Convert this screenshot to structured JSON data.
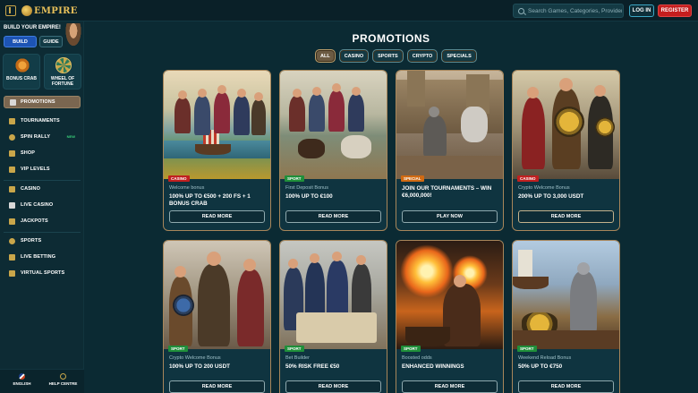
{
  "brand": {
    "logo_text": "EMPIRE"
  },
  "header": {
    "search_placeholder": "Search Games, Categories, Providers",
    "login_label": "LOG IN",
    "register_label": "REGISTER"
  },
  "sidebar": {
    "build_title": "BUILD YOUR EMPIRE!",
    "build_button": "BUILD",
    "guide_button": "GUIDE",
    "tiles": [
      {
        "label": "BONUS CRAB",
        "icon": "crab-coin-icon"
      },
      {
        "label": "WHEEL OF FORTUNE",
        "icon": "wheel-icon"
      }
    ],
    "active_item": {
      "label": "PROMOTIONS",
      "icon": "gift-icon"
    },
    "group1": [
      {
        "label": "TOURNAMENTS",
        "icon": "trophy-icon"
      },
      {
        "label": "SPIN RALLY",
        "icon": "spin-icon",
        "badge": "NEW"
      },
      {
        "label": "SHOP",
        "icon": "shop-icon"
      },
      {
        "label": "VIP LEVELS",
        "icon": "crown-icon"
      }
    ],
    "group2": [
      {
        "label": "CASINO",
        "icon": "casino-icon"
      },
      {
        "label": "LIVE CASINO",
        "icon": "live-casino-icon"
      },
      {
        "label": "JACKPOTS",
        "icon": "jackpot-icon"
      }
    ],
    "group3": [
      {
        "label": "SPORTS",
        "icon": "sports-icon"
      },
      {
        "label": "LIVE BETTING",
        "icon": "live-betting-icon"
      },
      {
        "label": "VIRTUAL SPORTS",
        "icon": "virtual-sports-icon"
      }
    ],
    "footer": {
      "language": "ENGLISH",
      "help": "HELP CENTRE"
    }
  },
  "main": {
    "title": "PROMOTIONS",
    "filters": [
      "ALL",
      "CASINO",
      "SPORTS",
      "CRYPTO",
      "SPECIALS"
    ],
    "active_filter": "ALL",
    "cards": [
      {
        "tag": "CASINO",
        "subtitle": "Welcome bonus",
        "title": "100% UP TO €500 + 200 FS + 1 BONUS CRAB",
        "button": "READ MORE"
      },
      {
        "tag": "SPORT",
        "subtitle": "First Deposit Bonus",
        "title": "100% UP TO €100",
        "button": "READ MORE"
      },
      {
        "tag": "SPECIAL",
        "subtitle": "",
        "title": "JOIN OUR TOURNAMENTS – WIN €6,000,000!",
        "button": "PLAY NOW"
      },
      {
        "tag": "CASINO",
        "subtitle": "Crypto Welcome Bonus",
        "title": "200% UP TO 3,000 USDT",
        "button": "READ MORE"
      },
      {
        "tag": "SPORT",
        "subtitle": "Crypto Welcome Bonus",
        "title": "100% UP TO 200 USDT",
        "button": "READ MORE"
      },
      {
        "tag": "SPORT",
        "subtitle": "Bet Builder",
        "title": "50% RISK FREE €50",
        "button": "READ MORE"
      },
      {
        "tag": "SPORT",
        "subtitle": "Boosted odds",
        "title": "ENHANCED WINNINGS",
        "button": "READ MORE"
      },
      {
        "tag": "SPORT",
        "subtitle": "Weekend Reload Bonus",
        "title": "50% UP TO €750",
        "button": "READ MORE"
      }
    ]
  },
  "colors": {
    "background": "#0b2a33",
    "card_border": "#a8865a",
    "register": "#c41e1e",
    "login_border": "#3ba7c4",
    "build": "#1d54b4",
    "tag_casino": "#c02020",
    "tag_sport": "#1f8f3a",
    "tag_special": "#d06a12"
  }
}
